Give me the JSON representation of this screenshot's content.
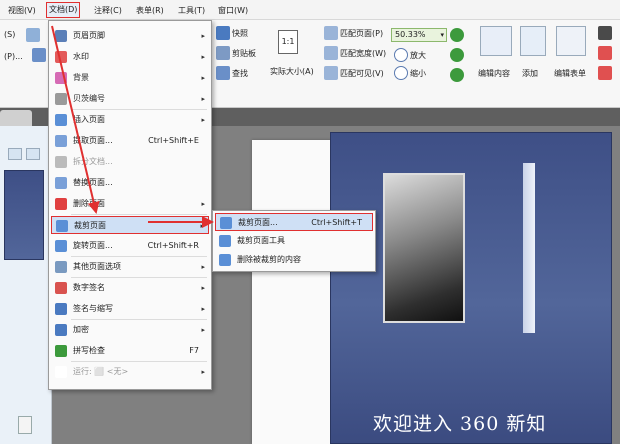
{
  "menubar": {
    "view": "视图(V)",
    "document": "文档(D)",
    "comment": "注释(C)",
    "form": "表单(R)",
    "tools": "工具(T)",
    "window": "窗口(W)"
  },
  "ribbon": {
    "snapshot": "快照",
    "clipboard": "剪贴板",
    "find": "查找",
    "actual_size": "实际大小(A)",
    "fit_page": "匹配页面(P)",
    "fit_width": "匹配宽度(W)",
    "fit_visible": "匹配可见(V)",
    "zoom_value": "50.33%",
    "zoom_in": "放大",
    "zoom_out": "缩小",
    "edit_content": "编辑内容",
    "add": "添加",
    "edit_form": "编辑表单",
    "left_s": "(S)",
    "left_p": "(P)..."
  },
  "document_menu": {
    "items": [
      {
        "label": "页眉页脚",
        "arrow": "▸",
        "color": "#5b7fb8"
      },
      {
        "label": "水印",
        "arrow": "▸",
        "color": "#e35a5a"
      },
      {
        "label": "背景",
        "arrow": "▸",
        "color": "#d66bb5"
      },
      {
        "label": "贝茨编号",
        "arrow": "▸",
        "color": "#9a9a9a"
      },
      {
        "label": "插入页面",
        "arrow": "▸",
        "color": "#5a8fd6"
      },
      {
        "label": "提取页面...",
        "shortcut": "Ctrl+Shift+E",
        "color": "#7aa0d8"
      },
      {
        "label": "拆分文档...",
        "color": "#bbbbbb",
        "disabled": true
      },
      {
        "label": "替换页面...",
        "color": "#7aa0d8"
      },
      {
        "label": "删除页面",
        "arrow": "▸",
        "color": "#e04040"
      },
      {
        "label": "裁剪页面",
        "arrow": "▸",
        "color": "#5a8fd6",
        "highlight": true
      },
      {
        "label": "旋转页面...",
        "shortcut": "Ctrl+Shift+R",
        "color": "#5a8fd6"
      },
      {
        "label": "其他页面选项",
        "arrow": "▸",
        "color": "#7a9ac0"
      },
      {
        "label": "数字签名",
        "arrow": "▸",
        "color": "#d9534f"
      },
      {
        "label": "签名与缩写",
        "arrow": "▸",
        "color": "#4a7ac0"
      },
      {
        "label": "加密",
        "arrow": "▸",
        "color": "#4a7ac0"
      },
      {
        "label": "拼写检查",
        "shortcut": "F7",
        "color": "#3c9a3c"
      },
      {
        "label": "运行: ⬜ <无>",
        "arrow": "▸",
        "color": "#ffffff",
        "disabled": true
      }
    ]
  },
  "crop_submenu": {
    "items": [
      {
        "label": "裁剪页面...",
        "shortcut": "Ctrl+Shift+T",
        "highlight": true,
        "color": "#5a8fd6"
      },
      {
        "label": "裁剪页面工具",
        "color": "#5a8fd6"
      },
      {
        "label": "删除被裁剪的内容",
        "color": "#5a8fd6"
      }
    ]
  },
  "document": {
    "cover_title": "欢迎进入 360 新知"
  },
  "colors": {
    "highlight_border": "#e03030",
    "menu_highlight": "#cfe0f5",
    "cover_blue": "#3e4f86"
  }
}
